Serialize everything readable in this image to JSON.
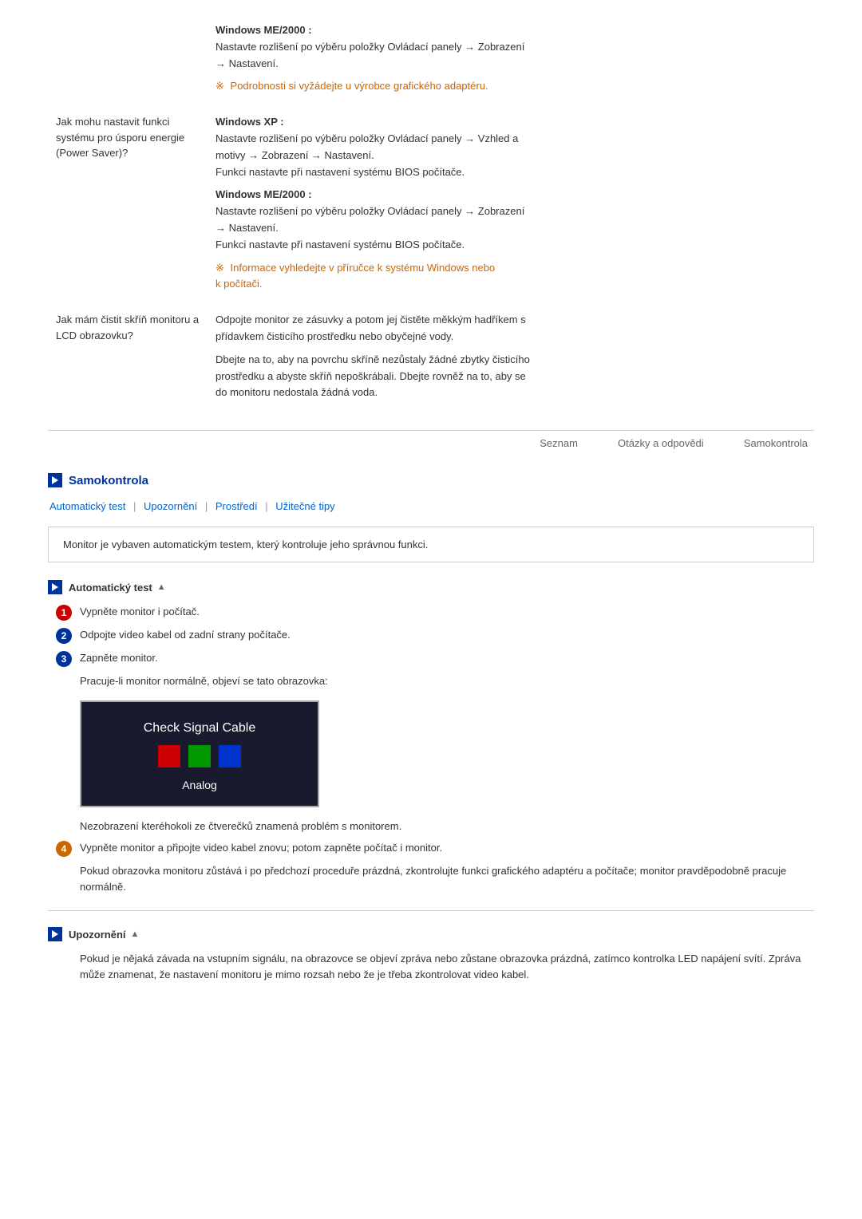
{
  "faq": {
    "rows": [
      {
        "question": "",
        "answers": [
          {
            "type": "normal",
            "lines": [
              "Windows ME/2000 :",
              "Nastavte rozlišení po výběru položky Ovládací panely → Zobrazení → Nastavení."
            ]
          },
          {
            "type": "note",
            "lines": [
              "Podrobnosti si vyžádejte u výrobce grafického adaptéru."
            ]
          }
        ]
      },
      {
        "question": "Jak mohu nastavit funkci systému pro úsporu energie (Power Saver)?",
        "answers": [
          {
            "type": "normal",
            "lines": [
              "Windows XP :",
              "Nastavte rozlišení po výběru položky Ovládací panely → Vzhled a motivy → Zobrazení → Nastavení.",
              "Funkci nastavte při nastavení systému BIOS počítače."
            ]
          },
          {
            "type": "normal",
            "lines": [
              "Windows ME/2000 :",
              "Nastavte rozlišení po výběru položky Ovládací panely → Zobrazení → Nastavení.",
              "Funkci nastavte při nastavení systému BIOS počítače."
            ]
          },
          {
            "type": "note",
            "lines": [
              "Informace vyhledejte v příručce k systému Windows nebo k počítači."
            ]
          }
        ]
      },
      {
        "question": "Jak mám čistit skříň monitoru a LCD obrazovku?",
        "answers": [
          {
            "type": "normal",
            "lines": [
              "Odpojte monitor ze zásuvky a potom jej čistěte měkkým hadříkem s přídavkem čisticího prostředku nebo obyčejné vody."
            ]
          },
          {
            "type": "normal",
            "lines": [
              "Dbejte na to, aby na povrchu skříně nezůstaly žádné zbytky čisticího prostředku a abyste skříň nepoškrábali. Dbejte rovněž na to, aby se do monitoru nedostala žádná voda."
            ]
          }
        ]
      }
    ]
  },
  "nav": {
    "items": [
      "Seznam",
      "Otázky a odpovědi",
      "Samokontrola"
    ]
  },
  "samokontrola": {
    "title": "Samokontrola",
    "subnav": [
      "Automatický test",
      "Upozornění",
      "Prostředí",
      "Užitečné tipy"
    ],
    "info_box": "Monitor je vybaven automatickým testem, který kontroluje jeho správnou funkci.",
    "auto_test": {
      "title": "Automatický test",
      "steps": [
        {
          "num": "1",
          "color": "red",
          "text": "Vypněte monitor i počítač."
        },
        {
          "num": "2",
          "color": "blue",
          "text": "Odpojte video kabel od zadní strany počítače."
        },
        {
          "num": "3",
          "color": "blue",
          "text": "Zapněte monitor."
        },
        {
          "num": "4",
          "color": "orange",
          "text": "Vypněte monitor a připojte video kabel znovu; potom zapněte počítač i monitor."
        }
      ],
      "step3_indent": "Pracuje-li monitor normálně, objeví se tato obrazovka:",
      "monitor_text": "Check Signal Cable",
      "monitor_squares": [
        "red",
        "green",
        "blue"
      ],
      "monitor_analog": "Analog",
      "step4_indent": "Pokud obrazovka monitoru zůstává i po předchozí proceduře prázdná, zkontrolujte funkci grafického adaptéru a počítače; monitor pravděpodobně pracuje normálně.",
      "no_squares_text": "Nezobrazení kteréhokoli ze čtverečků znamená problém s monitorem."
    },
    "upozorneni": {
      "title": "Upozornění",
      "text": "Pokud je nějaká závada na vstupním signálu, na obrazovce se objeví zpráva nebo zůstane obrazovka prázdná, zatímco kontrolka LED napájení svítí. Zpráva může znamenat, že nastavení monitoru je mimo rozsah nebo že je třeba zkontrolovat video kabel."
    }
  }
}
